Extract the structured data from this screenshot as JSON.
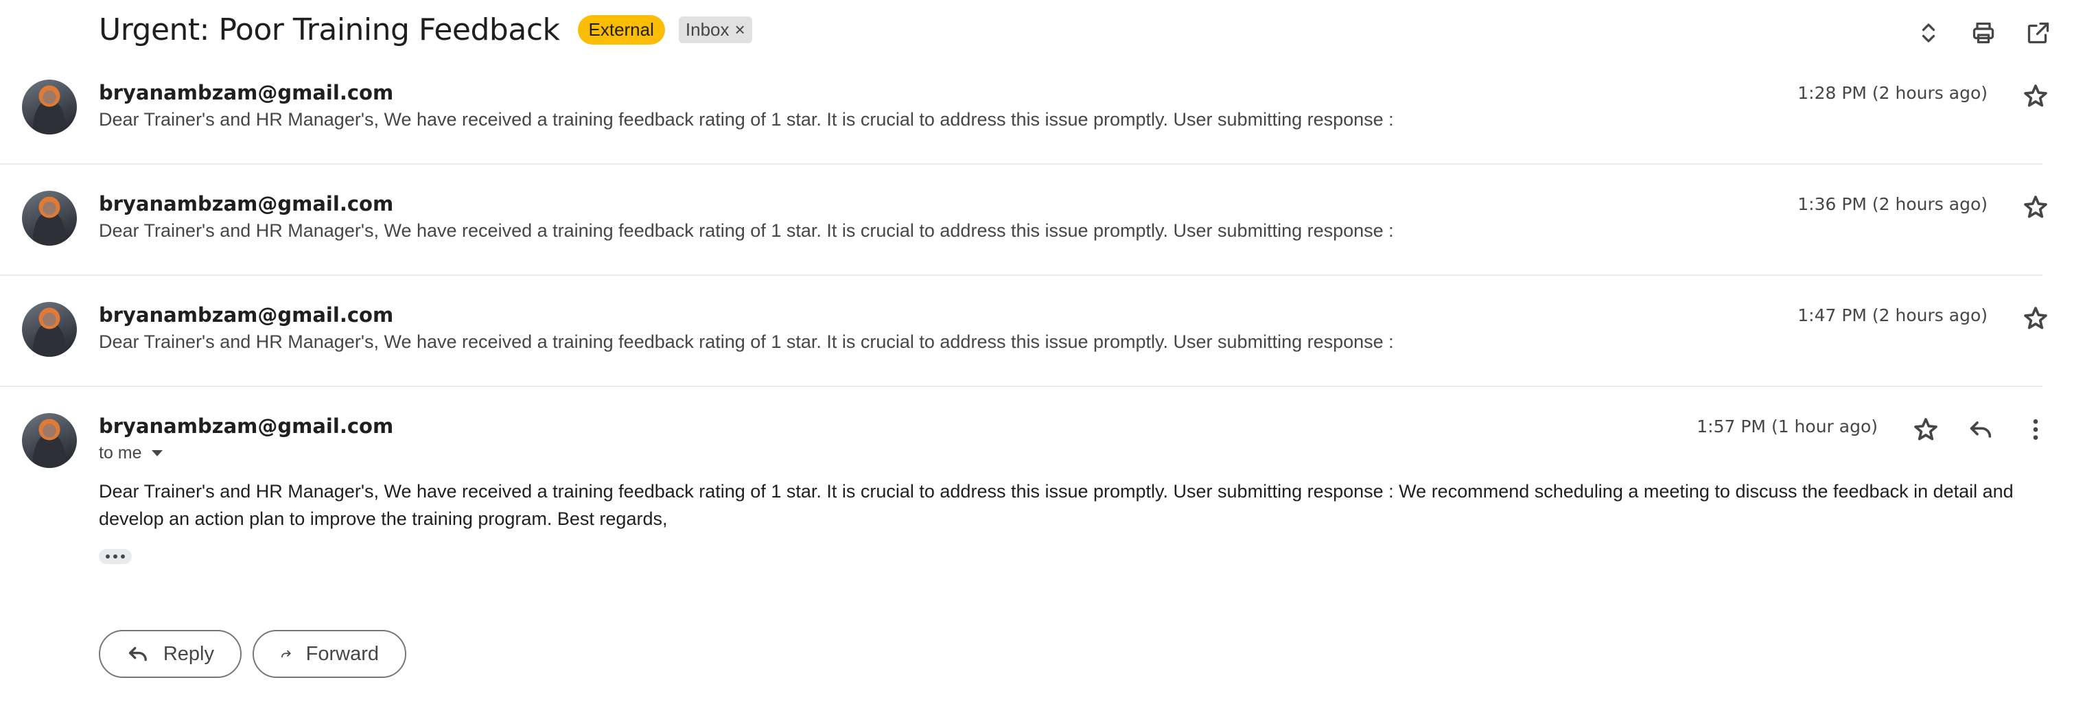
{
  "thread": {
    "subject": "Urgent: Poor Training Feedback",
    "labels": {
      "external": "External",
      "inbox": "Inbox",
      "inbox_remove": "×"
    }
  },
  "top_actions": [
    "expand-all-icon",
    "print-icon",
    "open-in-new-window-icon"
  ],
  "messages": [
    {
      "sender": "bryanambzam@gmail.com",
      "time": "1:28 PM (2 hours ago)",
      "snippet": "Dear Trainer's and HR Manager's, We have received a training feedback rating of 1 star. It is crucial to address this issue promptly. User submitting response :"
    },
    {
      "sender": "bryanambzam@gmail.com",
      "time": "1:36 PM (2 hours ago)",
      "snippet": "Dear Trainer's and HR Manager's, We have received a training feedback rating of 1 star. It is crucial to address this issue promptly. User submitting response :"
    },
    {
      "sender": "bryanambzam@gmail.com",
      "time": "1:47 PM (2 hours ago)",
      "snippet": "Dear Trainer's and HR Manager's, We have received a training feedback rating of 1 star. It is crucial to address this issue promptly. User submitting response :"
    },
    {
      "sender": "bryanambzam@gmail.com",
      "time": "1:57 PM (1 hour ago)",
      "recipient": "to me",
      "body": "Dear Trainer's and HR Manager's, We have received a training feedback rating of 1 star. It is crucial to address this issue promptly. User submitting response : We recommend scheduling a meeting to discuss the feedback in detail and develop an action plan to improve the training program. Best regards,"
    }
  ],
  "actions": {
    "reply": "Reply",
    "forward": "Forward"
  },
  "colors": {
    "external_label": "#fbbc04",
    "inbox_label": "#e1e1e1",
    "text": "#1f1f1f",
    "muted": "#444746"
  }
}
